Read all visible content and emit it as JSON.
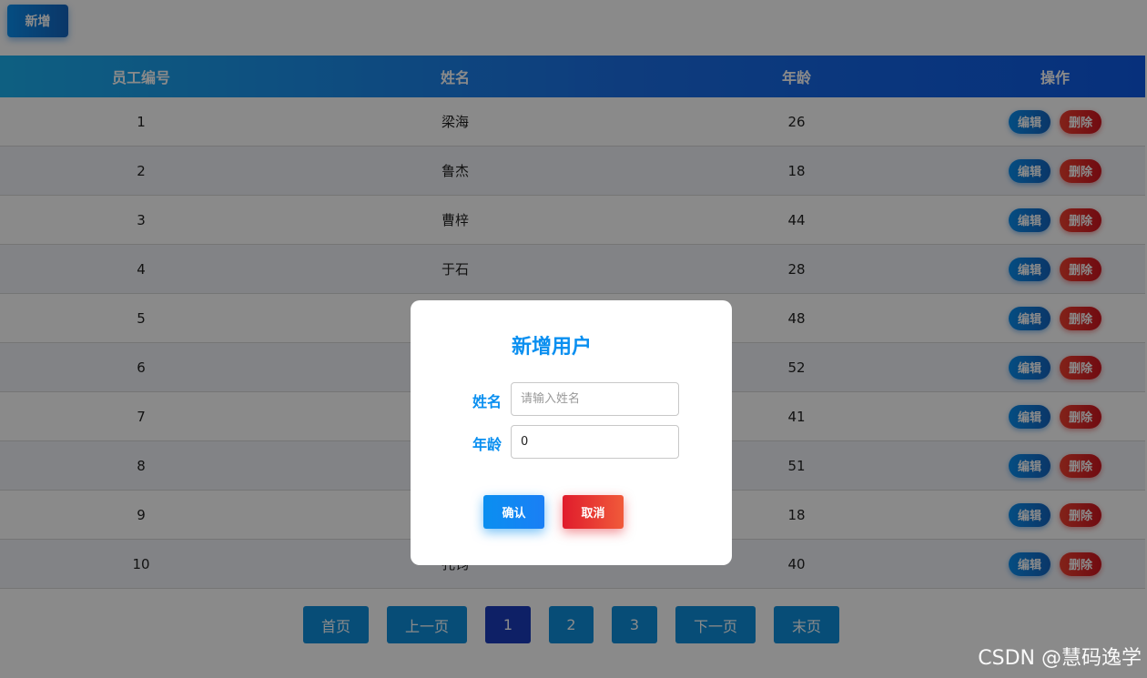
{
  "toolbar": {
    "add_label": "新增"
  },
  "table": {
    "headers": [
      "员工编号",
      "姓名",
      "年龄",
      "操作"
    ],
    "edit_label": "编辑",
    "delete_label": "删除",
    "rows": [
      {
        "id": "1",
        "name": "梁海",
        "age": "26"
      },
      {
        "id": "2",
        "name": "鲁杰",
        "age": "18"
      },
      {
        "id": "3",
        "name": "曹梓",
        "age": "44"
      },
      {
        "id": "4",
        "name": "于石",
        "age": "28"
      },
      {
        "id": "5",
        "name": "",
        "age": "48"
      },
      {
        "id": "6",
        "name": "",
        "age": "52"
      },
      {
        "id": "7",
        "name": "",
        "age": "41"
      },
      {
        "id": "8",
        "name": "",
        "age": "51"
      },
      {
        "id": "9",
        "name": "",
        "age": "18"
      },
      {
        "id": "10",
        "name": "孔钧",
        "age": "40"
      }
    ]
  },
  "pagination": {
    "first": "首页",
    "prev": "上一页",
    "pages": [
      "1",
      "2",
      "3"
    ],
    "current": "1",
    "next": "下一页",
    "last": "末页"
  },
  "dialog": {
    "title": "新增用户",
    "name_label": "姓名",
    "name_placeholder": "请输入姓名",
    "name_value": "",
    "age_label": "年龄",
    "age_value": "0",
    "confirm_label": "确认",
    "cancel_label": "取消"
  },
  "watermark": "CSDN @慧码逸学"
}
